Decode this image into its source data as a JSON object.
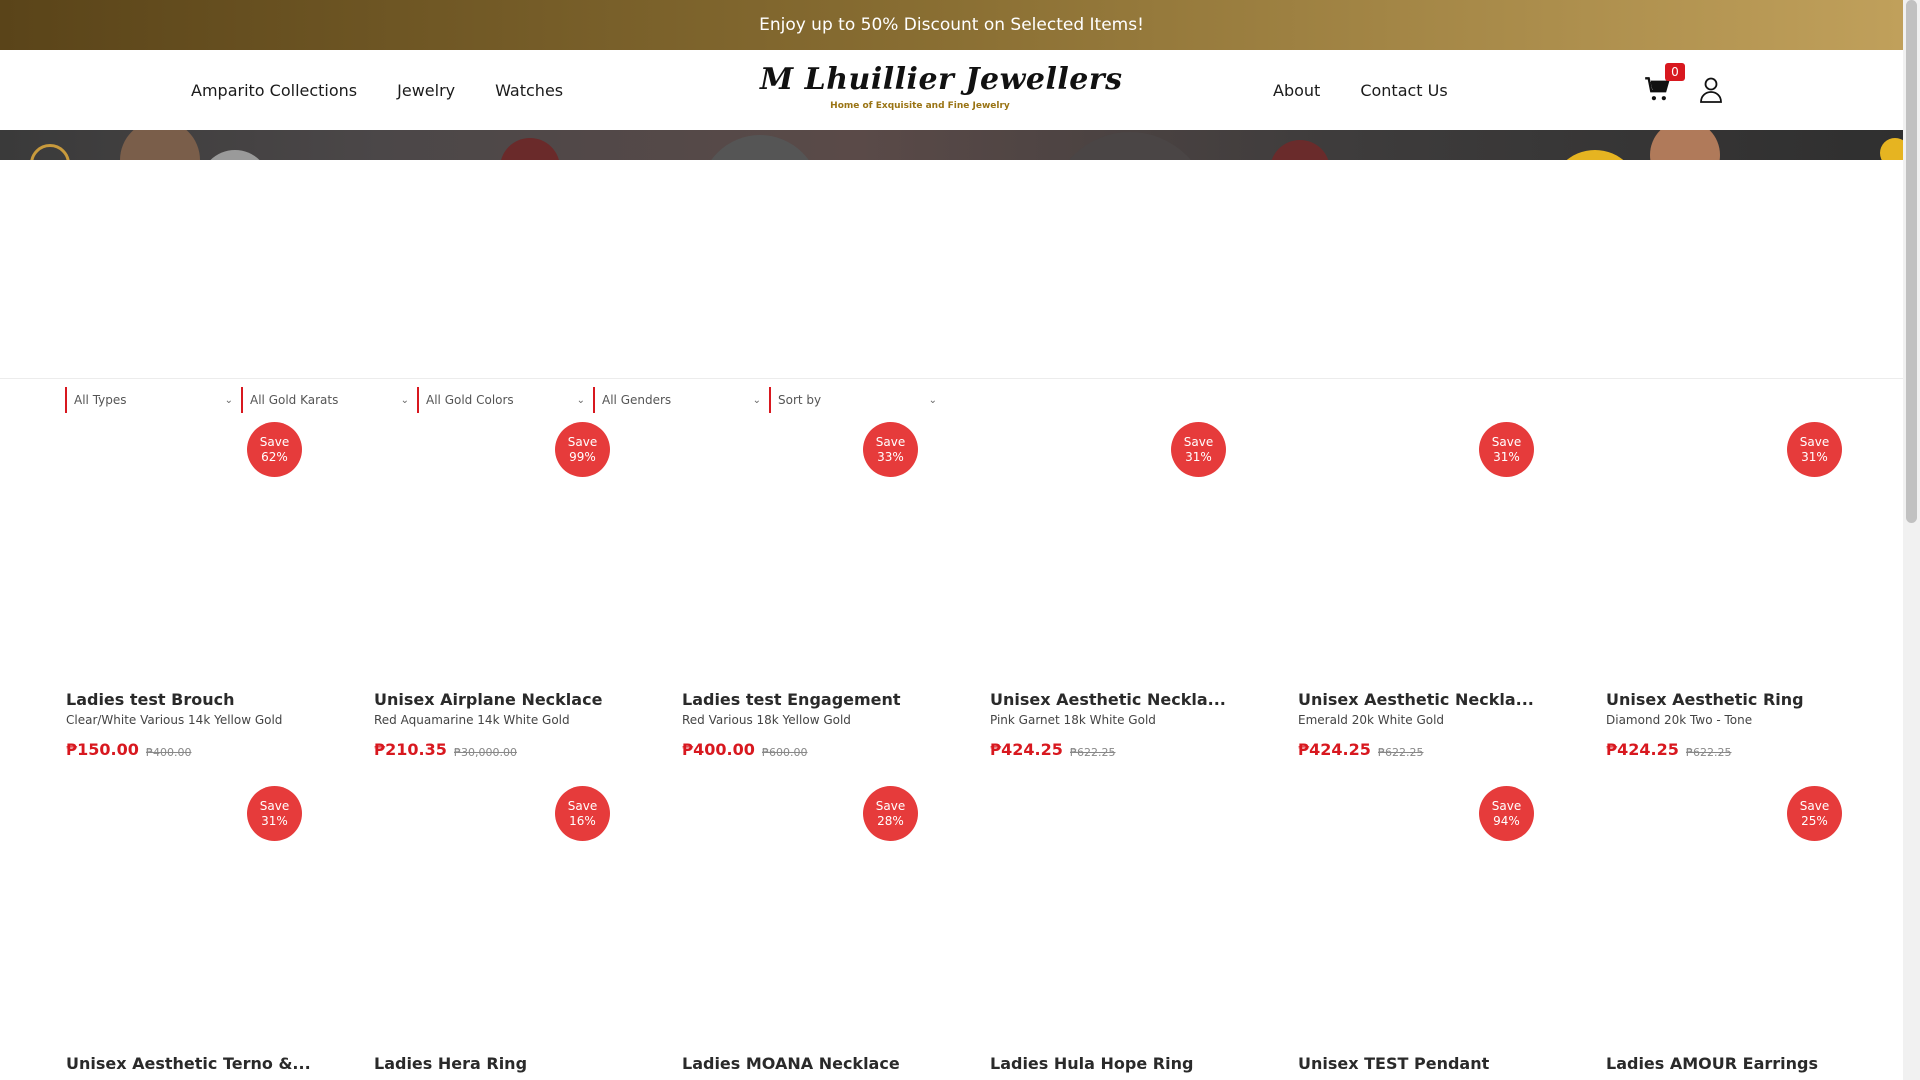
{
  "promo": {
    "text": "Enjoy up to 50% Discount on Selected Items!"
  },
  "nav": {
    "left": [
      "Amparito Collections",
      "Jewelry",
      "Watches"
    ],
    "right": [
      "About",
      "Contact Us"
    ]
  },
  "logo": {
    "main": "M Lhuillier Jewellers",
    "sub": "Home of Exquisite and Fine Jewelry"
  },
  "cart": {
    "count": "0"
  },
  "filters": [
    "All Types",
    "All Gold Karats",
    "All Gold Colors",
    "All Genders",
    "Sort by"
  ],
  "products": [
    {
      "title": "Ladies test Brouch",
      "sub": "Clear/White Various 14k Yellow Gold",
      "price": "₱150.00",
      "old": "₱400.00",
      "save_line1": "Save",
      "save_line2": "62%"
    },
    {
      "title": "Unisex Airplane Necklace",
      "sub": "Red Aquamarine 14k White Gold",
      "price": "₱210.35",
      "old": "₱30,000.00",
      "save_line1": "Save",
      "save_line2": "99%"
    },
    {
      "title": "Ladies test Engagement",
      "sub": "Red Various 18k Yellow Gold",
      "price": "₱400.00",
      "old": "₱600.00",
      "save_line1": "Save",
      "save_line2": "33%"
    },
    {
      "title": "Unisex Aesthetic Neckla...",
      "sub": "Pink Garnet 18k White Gold",
      "price": "₱424.25",
      "old": "₱622.25",
      "save_line1": "Save",
      "save_line2": "31%"
    },
    {
      "title": "Unisex Aesthetic Neckla...",
      "sub": "Emerald 20k White Gold",
      "price": "₱424.25",
      "old": "₱622.25",
      "save_line1": "Save",
      "save_line2": "31%"
    },
    {
      "title": "Unisex Aesthetic Ring",
      "sub": "Diamond 20k Two - Tone",
      "price": "₱424.25",
      "old": "₱622.25",
      "save_line1": "Save",
      "save_line2": "31%"
    },
    {
      "title": "Unisex Aesthetic Terno &...",
      "sub": "",
      "price": "",
      "old": "",
      "save_line1": "Save",
      "save_line2": "31%"
    },
    {
      "title": "Ladies Hera Ring",
      "sub": "",
      "price": "",
      "old": "",
      "save_line1": "Save",
      "save_line2": "16%"
    },
    {
      "title": "Ladies MOANA Necklace",
      "sub": "",
      "price": "",
      "old": "",
      "save_line1": "Save",
      "save_line2": "28%"
    },
    {
      "title": "Ladies Hula Hope Ring",
      "sub": "",
      "price": "",
      "old": "",
      "save_line1": "",
      "save_line2": ""
    },
    {
      "title": "Unisex TEST Pendant",
      "sub": "",
      "price": "",
      "old": "",
      "save_line1": "Save",
      "save_line2": "94%"
    },
    {
      "title": "Ladies AMOUR Earrings",
      "sub": "",
      "price": "",
      "old": "",
      "save_line1": "Save",
      "save_line2": "25%"
    }
  ],
  "colors": {
    "accent": "#d8181f",
    "badge": "#e63b3b",
    "gold": "#9a7414"
  }
}
